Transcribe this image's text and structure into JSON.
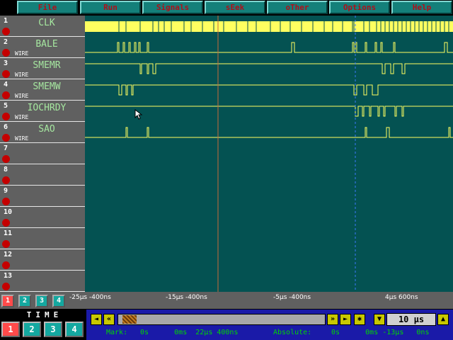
{
  "menu": [
    "File",
    "Run",
    "Signals",
    "sEek",
    "oTher",
    "Options",
    "Help"
  ],
  "channels": [
    {
      "num": "1",
      "name": "CLK",
      "type": ""
    },
    {
      "num": "2",
      "name": "BALE",
      "type": "WIRE"
    },
    {
      "num": "3",
      "name": "SMEMR",
      "type": "WIRE"
    },
    {
      "num": "4",
      "name": "SMEMW",
      "type": "WIRE"
    },
    {
      "num": "5",
      "name": "IOCHRDY",
      "type": "WIRE"
    },
    {
      "num": "6",
      "name": "SAO",
      "type": "WIRE"
    },
    {
      "num": "7",
      "name": "",
      "type": ""
    },
    {
      "num": "8",
      "name": "",
      "type": ""
    },
    {
      "num": "9",
      "name": "",
      "type": ""
    },
    {
      "num": "10",
      "name": "",
      "type": ""
    },
    {
      "num": "11",
      "name": "",
      "type": ""
    },
    {
      "num": "12",
      "name": "",
      "type": ""
    },
    {
      "num": "13",
      "name": "",
      "type": ""
    }
  ],
  "ruler": {
    "pages": [
      "1",
      "2",
      "3",
      "4"
    ],
    "labels": [
      "-25μs -400ns",
      "-15μs -400ns",
      "-5μs -400ns",
      "4μs 600ns"
    ]
  },
  "bottom": {
    "title": "TIME",
    "buttons": [
      "1",
      "2",
      "3",
      "4"
    ],
    "scale": "10 μs",
    "mark_label": "Mark:",
    "mark_value": "0s      0ms  22μs 400ns",
    "absolute_label": "Absolute:",
    "absolute_value": "0s      0ms -13μs   0ns"
  },
  "colors": {
    "wave": "#ffff60",
    "cursor_red": "#c86a3a",
    "cursor_blue": "#3c78ff",
    "background": "#045252"
  }
}
